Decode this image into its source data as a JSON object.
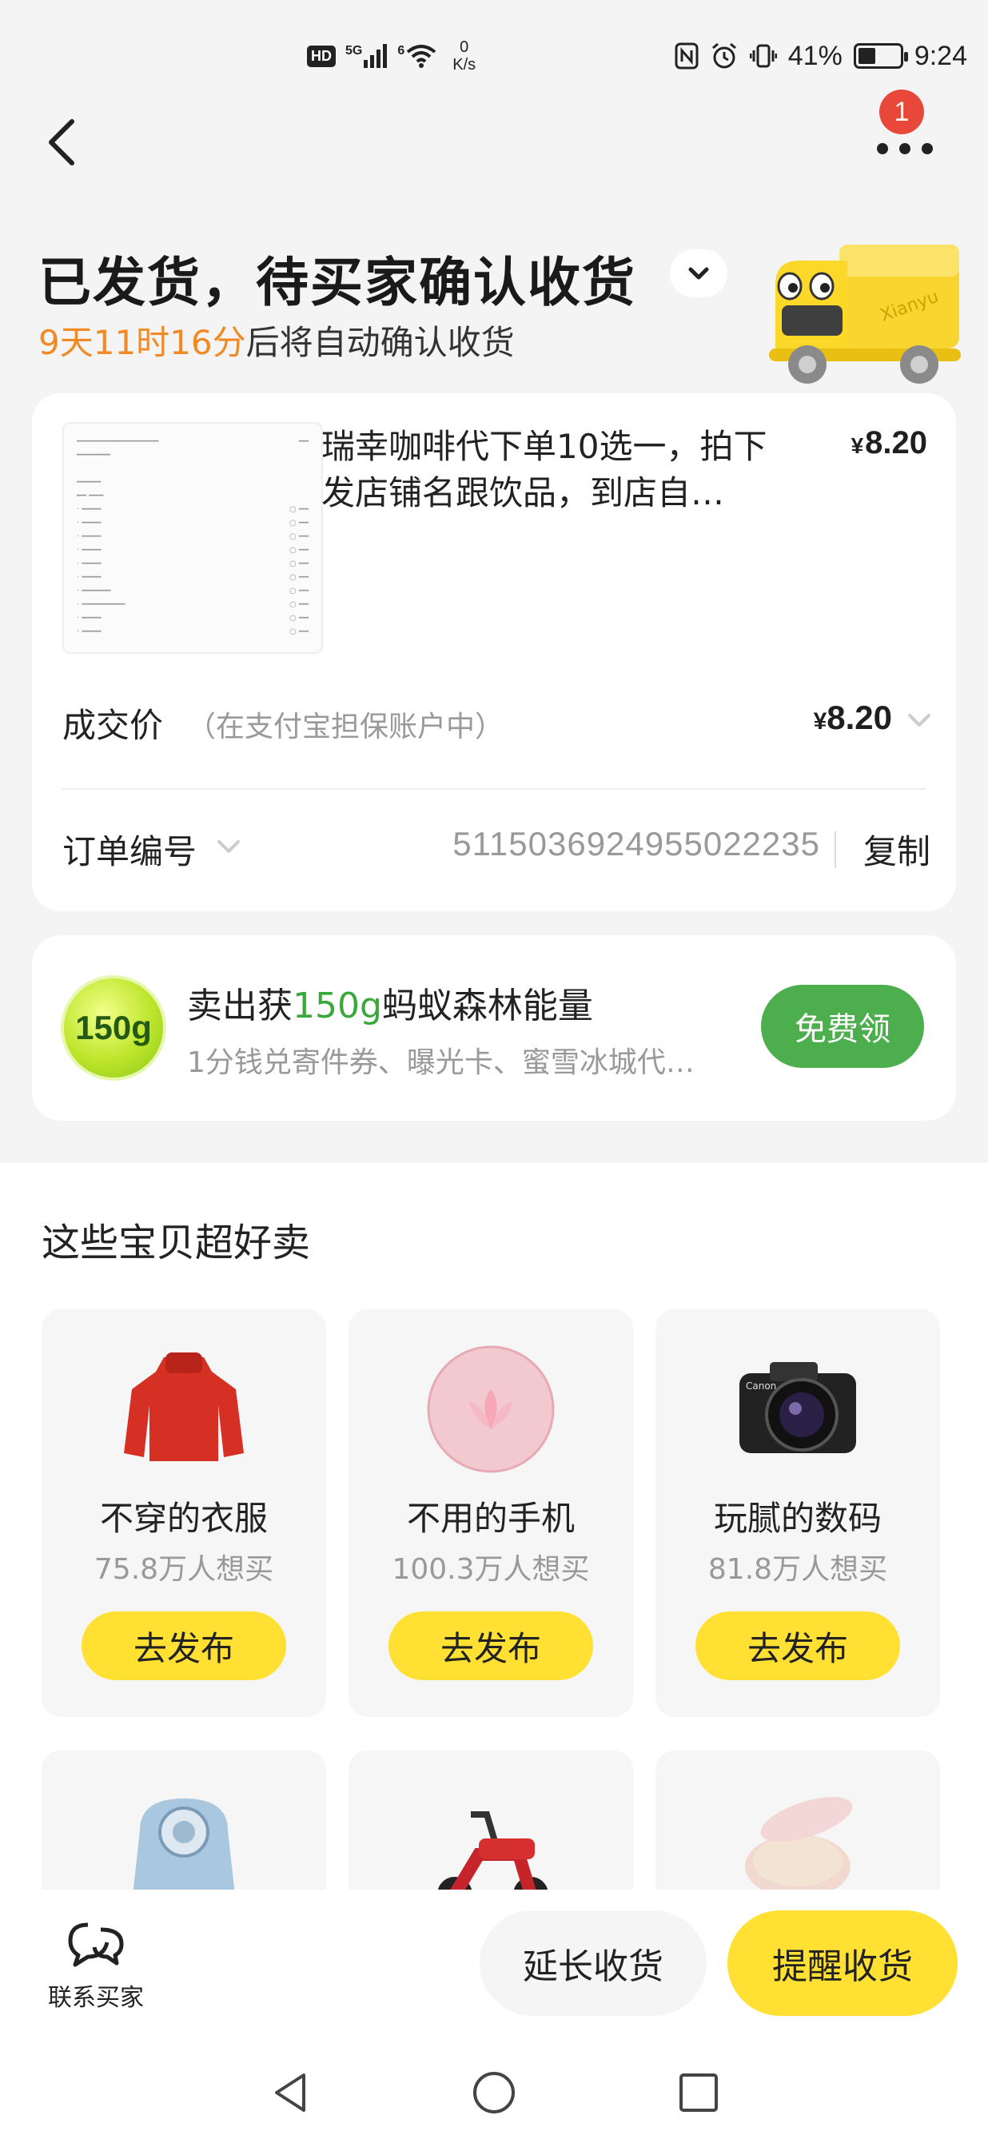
{
  "status_bar": {
    "hd": "HD",
    "signal_1": "5G",
    "signal_2": "6",
    "net_speed_value": "0",
    "net_speed_unit": "K/s",
    "battery_percent": "41%",
    "time": "9:24",
    "battery_level": 0.41
  },
  "nav": {
    "back_icon": "chevron-left-icon",
    "more_icon": "more-dots-icon",
    "more_badge": "1"
  },
  "header": {
    "title": "已发货，待买家确认收货",
    "countdown_time": "9天11时16分",
    "countdown_suffix": "后将自动确认收货"
  },
  "order": {
    "product_title": "瑞幸咖啡代下单10选一，拍下发店铺名跟饮品，到店自…",
    "product_price_symbol": "¥",
    "product_price": "8.20",
    "deal_label": "成交价",
    "deal_note": "（在支付宝担保账户中）",
    "deal_price_symbol": "¥",
    "deal_price": "8.20",
    "order_label": "订单编号",
    "order_number": "5115036924955022235",
    "copy_label": "复制"
  },
  "energy": {
    "badge": "150g",
    "title_prefix": "卖出获",
    "title_highlight": "150g",
    "title_suffix": "蚂蚁森林能量",
    "subtitle": "1分钱兑寄件券、曝光卡、蜜雪冰城代…",
    "button": "免费领",
    "accent": "#3aa83a"
  },
  "recommend": {
    "title": "这些宝贝超好卖",
    "items": [
      {
        "name": "不穿的衣服",
        "count": "75.8万人想买",
        "button": "去发布",
        "icon": "sweater-icon"
      },
      {
        "name": "不用的手机",
        "count": "100.3万人想买",
        "button": "去发布",
        "icon": "phone-icon"
      },
      {
        "name": "玩腻的数码",
        "count": "81.8万人想买",
        "button": "去发布",
        "icon": "camera-icon"
      }
    ],
    "row2_icons": [
      "armchair-icon",
      "scooter-icon",
      "cushion-compact-icon"
    ]
  },
  "bottom": {
    "contact_label": "联系买家",
    "extend_label": "延长收货",
    "remind_label": "提醒收货",
    "accent_yellow": "#ffe033"
  }
}
